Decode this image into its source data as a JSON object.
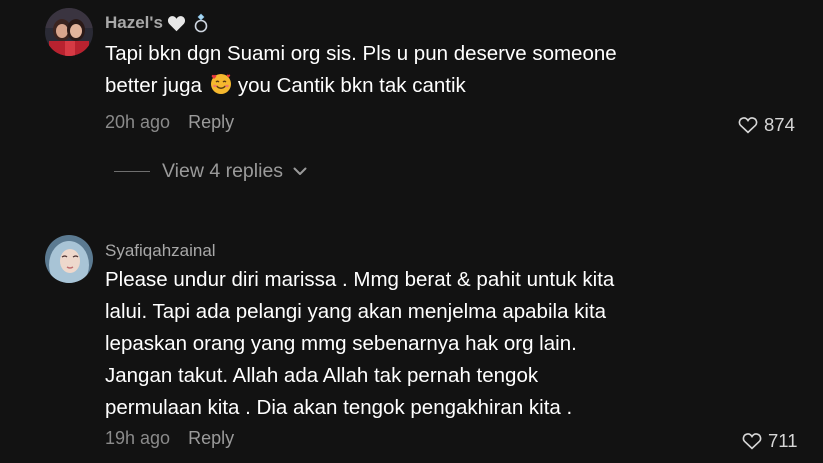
{
  "comments": [
    {
      "username": "Hazel's",
      "body_lines": [
        "Tapi bkn dgn Suami org sis. Pls u pun deserve someone",
        "better juga",
        "you Cantik bkn tak cantik"
      ],
      "time": "20h ago",
      "reply_label": "Reply",
      "likes": "874",
      "view_replies": "View 4 replies"
    },
    {
      "username": "Syafiqahzainal",
      "body_lines": [
        "Please undur diri marissa . Mmg berat & pahit untuk kita",
        "lalui. Tapi ada pelangi yang akan menjelma apabila kita",
        "lepaskan orang yang mmg sebenarnya hak org lain.",
        "Jangan takut. Allah ada Allah tak pernah tengok",
        "permulaan kita . Dia akan tengok pengakhiran kita ."
      ],
      "time": "19h ago",
      "reply_label": "Reply",
      "likes": "711"
    }
  ],
  "icons": {
    "heart": "heart-outline-icon",
    "white_heart": "white-heart-icon",
    "ring": "ring-icon",
    "emoji": "smiling-face-with-hearts-icon",
    "chevron": "chevron-down-icon"
  },
  "colors": {
    "background": "#121212",
    "text": "#ffffff",
    "muted": "#8a8a8a"
  }
}
